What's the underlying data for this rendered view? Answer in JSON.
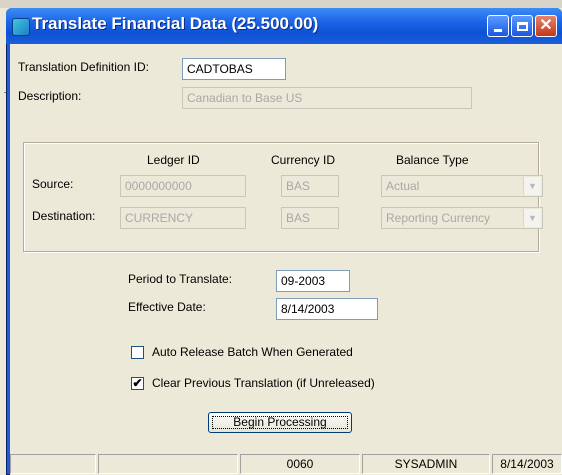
{
  "window": {
    "title": "Translate Financial Data (25.500.00)"
  },
  "form": {
    "translation_definition_id": {
      "label": "Translation Definition ID:",
      "value": "CADTOBAS"
    },
    "description": {
      "label": "Description:",
      "value": "Canadian to Base US"
    }
  },
  "group": {
    "headers": {
      "ledger_id": "Ledger ID",
      "currency_id": "Currency ID",
      "balance_type": "Balance Type"
    },
    "source": {
      "label": "Source:",
      "ledger_id": "0000000000",
      "currency_id": "BAS",
      "balance_type": "Actual"
    },
    "destination": {
      "label": "Destination:",
      "ledger_id": "CURRENCY",
      "currency_id": "BAS",
      "balance_type": "Reporting Currency"
    }
  },
  "period": {
    "label": "Period to Translate:",
    "value": "09-2003"
  },
  "effective_date": {
    "label": "Effective Date:",
    "value": "8/14/2003"
  },
  "options": {
    "auto_release": {
      "label": "Auto Release Batch When Generated",
      "checked": false
    },
    "clear_previous": {
      "label": "Clear Previous Translation (if Unreleased)",
      "checked": true,
      "mark": "✔"
    }
  },
  "actions": {
    "begin_processing": "Begin Processing"
  },
  "statusbar": {
    "company": "0060",
    "user": "SYSADMIN",
    "date": "8/14/2003"
  }
}
